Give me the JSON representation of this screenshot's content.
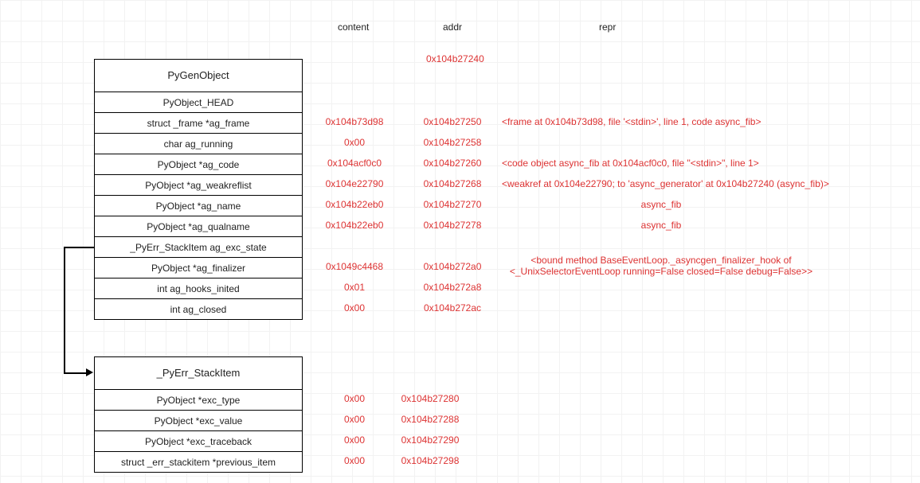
{
  "headers": {
    "content": "content",
    "addr": "addr",
    "repr": "repr"
  },
  "top_addr": "0x104b27240",
  "box1": {
    "title": "PyGenObject",
    "rows": [
      "PyObject_HEAD",
      "struct _frame *ag_frame",
      "char ag_running",
      "PyObject *ag_code",
      "PyObject *ag_weakreflist",
      "PyObject *ag_name",
      "PyObject *ag_qualname",
      "_PyErr_StackItem ag_exc_state",
      "PyObject *ag_finalizer",
      "int ag_hooks_inited",
      "int ag_closed"
    ]
  },
  "box2": {
    "title": "_PyErr_StackItem",
    "rows": [
      "PyObject *exc_type",
      "PyObject *exc_value",
      "PyObject *exc_traceback",
      "struct _err_stackitem *previous_item"
    ]
  },
  "vals1": [
    {
      "content": "",
      "addr": "",
      "repr": ""
    },
    {
      "content": "0x104b73d98",
      "addr": "0x104b27250",
      "repr": "<frame at 0x104b73d98, file '<stdin>', line 1, code async_fib>"
    },
    {
      "content": "0x00",
      "addr": "0x104b27258",
      "repr": ""
    },
    {
      "content": "0x104acf0c0",
      "addr": "0x104b27260",
      "repr": "<code object async_fib at 0x104acf0c0, file \"<stdin>\", line 1>"
    },
    {
      "content": "0x104e22790",
      "addr": "0x104b27268",
      "repr": "<weakref at 0x104e22790; to 'async_generator' at 0x104b27240 (async_fib)>"
    },
    {
      "content": "0x104b22eb0",
      "addr": "0x104b27270",
      "repr": "async_fib"
    },
    {
      "content": "0x104b22eb0",
      "addr": "0x104b27278",
      "repr": "async_fib"
    },
    {
      "content": "",
      "addr": "",
      "repr": ""
    },
    {
      "content": "0x1049c4468",
      "addr": "0x104b272a0",
      "repr": "<bound method BaseEventLoop._asyncgen_finalizer_hook of\n<_UnixSelectorEventLoop running=False closed=False debug=False>>"
    },
    {
      "content": "0x01",
      "addr": "0x104b272a8",
      "repr": ""
    },
    {
      "content": "0x00",
      "addr": "0x104b272ac",
      "repr": ""
    }
  ],
  "vals2": [
    {
      "content": "0x00",
      "addr": "0x104b27280",
      "repr": ""
    },
    {
      "content": "0x00",
      "addr": "0x104b27288",
      "repr": ""
    },
    {
      "content": "0x00",
      "addr": "0x104b27290",
      "repr": ""
    },
    {
      "content": "0x00",
      "addr": "0x104b27298",
      "repr": ""
    }
  ]
}
